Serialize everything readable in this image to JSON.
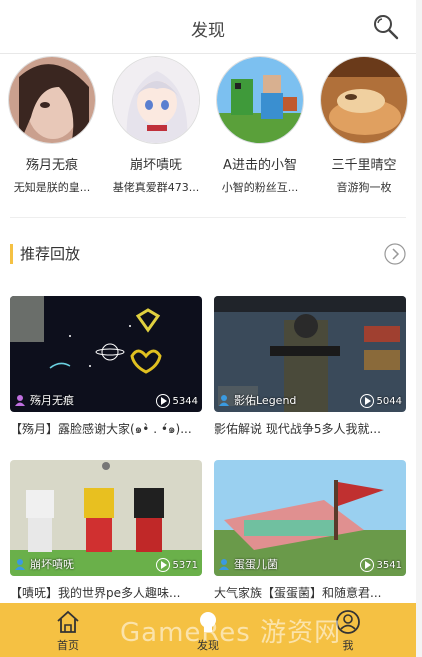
{
  "header": {
    "title": "发现"
  },
  "users": [
    {
      "name": "殇月无痕",
      "desc": "无知是朕的皇..."
    },
    {
      "name": "崩坏嘖呒",
      "desc": "基佬真爱群473..."
    },
    {
      "name": "A进击的小智",
      "desc": "小智的粉丝互..."
    },
    {
      "name": "三千里晴空",
      "desc": "音游狗一枚"
    }
  ],
  "section": {
    "title": "推荐回放"
  },
  "cards": [
    {
      "author": "殇月无痕",
      "views": "5344",
      "title": "【殇月】露脸感谢大家(๑•̀ . •́๑)..."
    },
    {
      "author": "影佑Legend",
      "views": "5044",
      "title": "影佑解说 现代战争5多人我就..."
    },
    {
      "author": "崩坏嘖呒",
      "views": "5371",
      "title": "【嘖呒】我的世界pe多人趣味..."
    },
    {
      "author": "蛋蛋儿菌",
      "views": "3541",
      "title": "大气家族【蛋蛋菌】和随意君..."
    }
  ],
  "tabs": [
    {
      "label": "首页"
    },
    {
      "label": "发现"
    },
    {
      "label": "我"
    }
  ],
  "watermark": "GameRes 游资网",
  "colors": {
    "accent": "#f5c143"
  }
}
